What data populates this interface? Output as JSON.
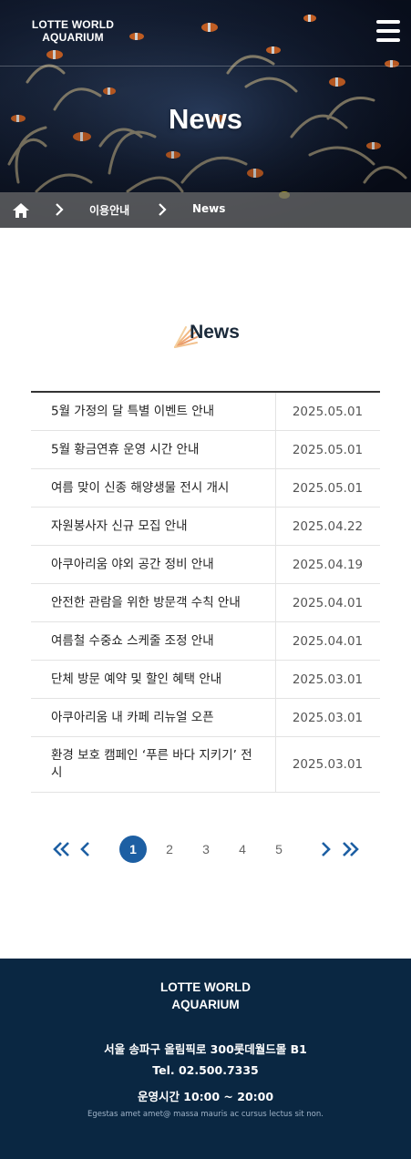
{
  "header": {
    "logo_line1": "LOTTE WORLD",
    "logo_line2": "AQUARIUM",
    "menu_icon": "hamburger-menu-icon"
  },
  "hero": {
    "title": "News"
  },
  "breadcrumb": {
    "home_icon": "home-icon",
    "items": [
      "이용안내",
      "News"
    ]
  },
  "section": {
    "title": "News"
  },
  "news": [
    {
      "title": "5월 가정의 달 특별 이벤트 안내",
      "date": "2025.05.01"
    },
    {
      "title": "5월 황금연휴 운영 시간 안내",
      "date": "2025.05.01"
    },
    {
      "title": "여름 맞이 신종 해양생물 전시 개시",
      "date": "2025.05.01"
    },
    {
      "title": "자원봉사자 신규 모집 안내",
      "date": "2025.04.22"
    },
    {
      "title": "아쿠아리움 야외 공간 정비 안내",
      "date": "2025.04.19"
    },
    {
      "title": "안전한 관람을 위한 방문객 수칙 안내",
      "date": "2025.04.01"
    },
    {
      "title": "여름철 수중쇼 스케줄 조정 안내",
      "date": "2025.04.01"
    },
    {
      "title": "단체 방문 예약 및 할인 혜택 안내",
      "date": "2025.03.01"
    },
    {
      "title": "아쿠아리움 내 카페 리뉴얼 오픈",
      "date": "2025.03.01"
    },
    {
      "title": "환경 보호 캠페인 ‘푸른 바다 지키기’ 전시",
      "date": "2025.03.01"
    }
  ],
  "pagination": {
    "pages": [
      "1",
      "2",
      "3",
      "4",
      "5"
    ],
    "current": "1",
    "accent": "#1d5fa3"
  },
  "footer": {
    "logo_line1": "LOTTE WORLD",
    "logo_line2": "AQUARIUM",
    "address": "서울 송파구 올림픽로 300롯데월드몰 B1",
    "tel": "Tel. 02.500.7335",
    "hours": "운영시간 10:00 ~ 20:00",
    "note": "Egestas amet amet@ massa mauris ac cursus lectus sit non.",
    "background": "#0a2742"
  }
}
